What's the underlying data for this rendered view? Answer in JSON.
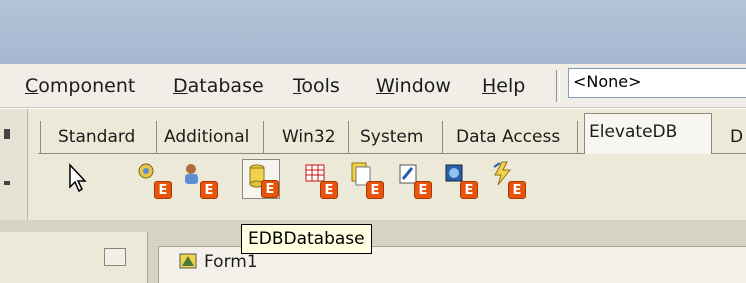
{
  "menu": {
    "items": [
      {
        "first": "C",
        "rest": "omponent"
      },
      {
        "first": "D",
        "rest": "atabase"
      },
      {
        "first": "T",
        "rest": "ools"
      },
      {
        "first": "W",
        "rest": "indow"
      },
      {
        "first": "H",
        "rest": "elp"
      }
    ],
    "combo_value": "<None>"
  },
  "palette": {
    "tabs": [
      "Standard",
      "Additional",
      "Win32",
      "System",
      "Data Access",
      "ElevateDB",
      "D"
    ],
    "active_tab": "ElevateDB",
    "components": [
      {
        "icon": "session-icon"
      },
      {
        "icon": "users-icon"
      },
      {
        "icon": "database-icon",
        "highlighted": true
      },
      {
        "icon": "table-icon"
      },
      {
        "icon": "query-icon"
      },
      {
        "icon": "storedproc-icon"
      },
      {
        "icon": "script-icon"
      },
      {
        "icon": "update-icon"
      }
    ],
    "badge_letter": "E",
    "tooltip": "EDBDatabase"
  },
  "form": {
    "title": "Form1"
  },
  "colors": {
    "title_bar": "#b3c4d9",
    "badge": "#e8540c",
    "tooltip_bg": "#ffffe1"
  }
}
